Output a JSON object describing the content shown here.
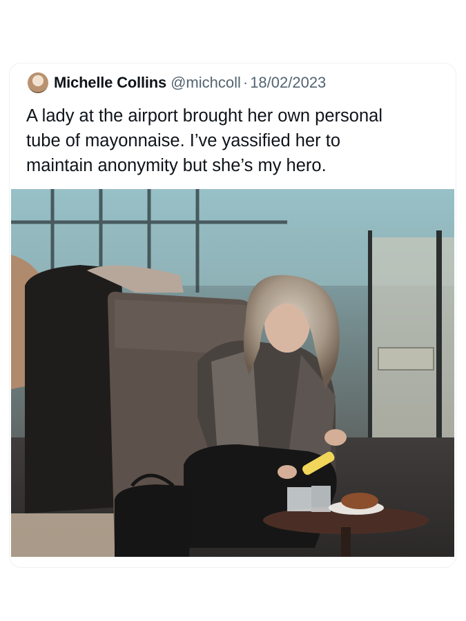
{
  "tweet": {
    "avatar_icon": "user-avatar",
    "author_name": "Michelle Collins",
    "author_handle": "@michcoll",
    "separator": "·",
    "date": "18/02/2023",
    "text": "A lady at the airport brought her own personal\ntube of mayonnaise. I’ve yassified her to\nmaintain anonymity but she’s my hero."
  }
}
